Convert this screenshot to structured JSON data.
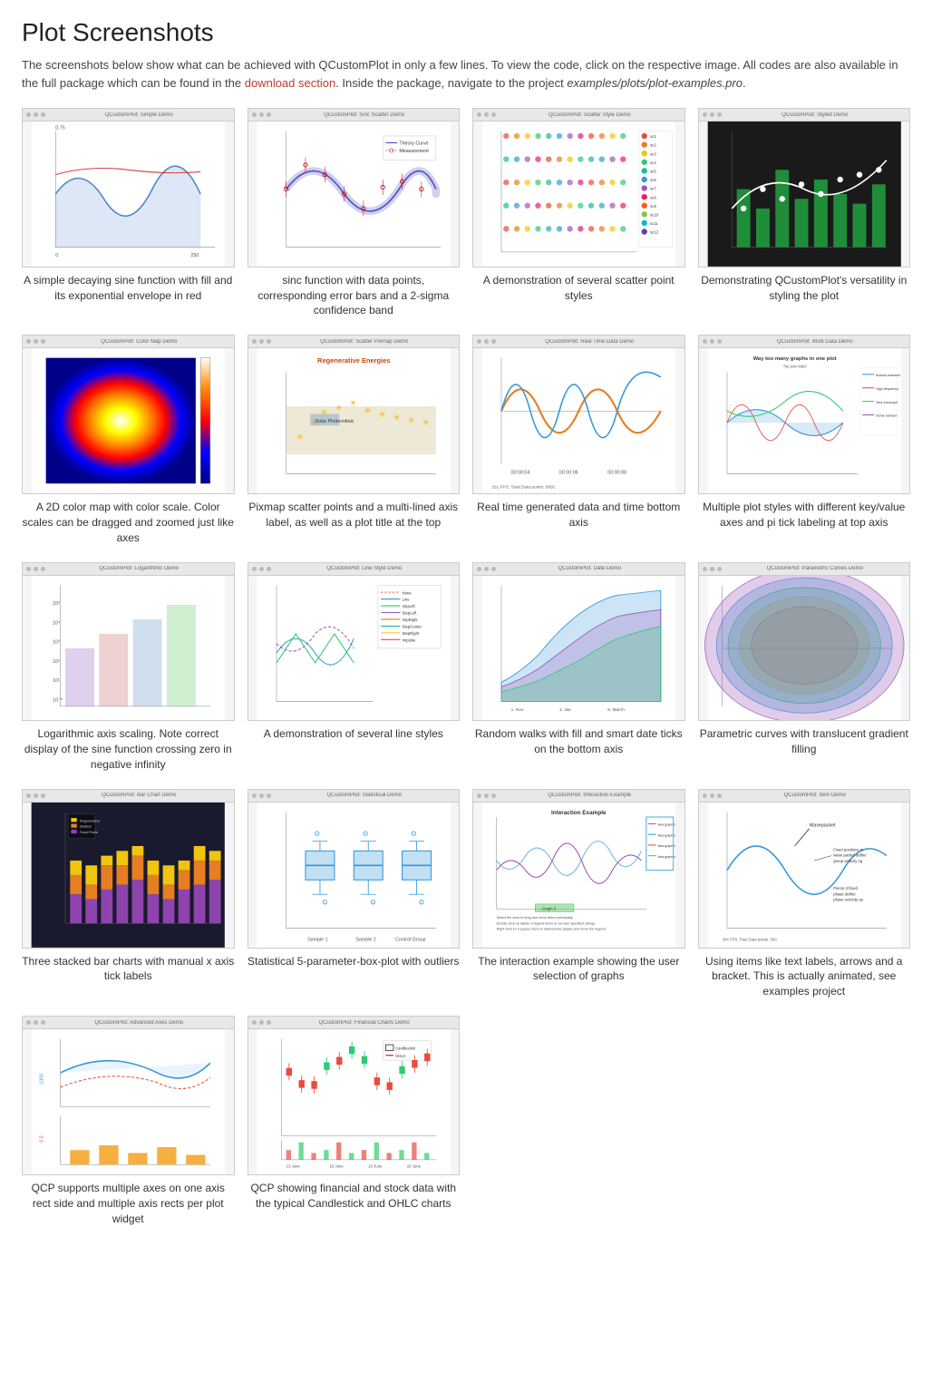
{
  "page": {
    "title": "Plot Screenshots",
    "intro_part1": "The screenshots below show what can be achieved with QCustomPlot in only a few lines. To view the code, click on the respective image. All codes are also available in the full package which can be found in the ",
    "intro_link": "download section",
    "intro_part2": ". Inside the package, navigate to the project ",
    "intro_path": "examples/plots/plot-examples.pro",
    "intro_end": "."
  },
  "plots": [
    {
      "id": "simple-demo",
      "chrome_title": "QCustomPlot: Simple Demo",
      "caption": "A simple decaying sine function with fill and its exponential envelope in red",
      "highlight_words": [],
      "color_scheme": "blue_red",
      "type": "line"
    },
    {
      "id": "sinc-scatter",
      "chrome_title": "QCustomPlot: Sinc Scatter Demo",
      "caption": "sinc function with data points, corresponding error bars and a 2-sigma confidence band",
      "highlight_words": [],
      "color_scheme": "red_blue",
      "type": "scatter_line"
    },
    {
      "id": "scatter-style",
      "chrome_title": "QCustomPlot: Scatter Style Demo",
      "caption": "A demonstration of several scatter point styles",
      "highlight_words": [
        "demonstration",
        "scatter"
      ],
      "color_scheme": "multicolor",
      "type": "scatter_multi"
    },
    {
      "id": "styled-demo",
      "chrome_title": "QCustomPlot: Styled Demo",
      "caption": "Demonstrating QCustomPlot's versatility in styling the plot",
      "highlight_words": [],
      "color_scheme": "dark_green",
      "type": "bar_dark"
    },
    {
      "id": "colormap",
      "chrome_title": "QCustomPlot: Color Map Demo",
      "caption": "A 2D color map with color scale. Color scales can be dragged and zoomed just like axes",
      "highlight_words": [],
      "color_scheme": "heatmap",
      "type": "colormap"
    },
    {
      "id": "scatter-pixmap",
      "chrome_title": "QCustomPlot: Scatter Pixmap Demo",
      "caption": "Pixmap scatter points and a multi-lined axis label, as well as a plot title at the top",
      "highlight_words": [],
      "color_scheme": "energy",
      "type": "pixmap_scatter"
    },
    {
      "id": "realtime",
      "chrome_title": "QCustomPlot: Real Time Data Demo",
      "caption": "Real time generated data and time bottom axis",
      "highlight_words": [
        "time"
      ],
      "color_scheme": "orange_blue",
      "type": "realtime"
    },
    {
      "id": "multi-data",
      "chrome_title": "QCustomPlot: Multi Data Demo",
      "caption": "Multiple plot styles with different key/value axes and pi tick labeling at top axis",
      "highlight_words": [
        "different"
      ],
      "color_scheme": "multi_axes",
      "type": "multi_axes"
    },
    {
      "id": "logarithmic",
      "chrome_title": "QCustomPlot: Logarithmic Demo",
      "caption": "Logarithmic axis scaling. Note correct display of the sine function crossing zero in negative infinity",
      "highlight_words": [],
      "color_scheme": "log_colors",
      "type": "logarithmic"
    },
    {
      "id": "line-style",
      "chrome_title": "QCustomPlot: Line Style Demo",
      "caption": "A demonstration of several line styles",
      "highlight_words": [],
      "color_scheme": "line_styles",
      "type": "line_styles"
    },
    {
      "id": "date-demo",
      "chrome_title": "QCustomPlot: Date Demo",
      "caption": "Random walks with fill and smart date ticks on the bottom axis",
      "highlight_words": [
        "fill"
      ],
      "color_scheme": "area_fill",
      "type": "area"
    },
    {
      "id": "parametric",
      "chrome_title": "QCustomPlot: Parametric Curves Demo",
      "caption": "Parametric curves with translucent gradient filling",
      "highlight_words": [],
      "color_scheme": "ellipses",
      "type": "parametric"
    },
    {
      "id": "bar-chart",
      "chrome_title": "QCustomPlot: Bar Chart Demo",
      "caption": "Three stacked bar charts with manual x axis tick labels",
      "highlight_words": [],
      "color_scheme": "bar_colors",
      "type": "bar_stacked"
    },
    {
      "id": "statistical",
      "chrome_title": "QCustomPlot: Statistical Demo",
      "caption": "Statistical 5-parameter-box-plot with outliers",
      "highlight_words": [],
      "color_scheme": "boxplot",
      "type": "boxplot"
    },
    {
      "id": "interaction",
      "chrome_title": "QCustomPlot: Interaction Example",
      "caption": "The interaction example showing the user selection of graphs",
      "highlight_words": [
        "selection"
      ],
      "color_scheme": "interaction",
      "type": "interaction"
    },
    {
      "id": "item-demo",
      "chrome_title": "QCustomPlot: Item Demo",
      "caption": "Using items like text labels, arrows and a bracket. This is actually animated, see examples project",
      "highlight_words": [],
      "color_scheme": "item_demo",
      "type": "item_demo"
    },
    {
      "id": "advanced-axes",
      "chrome_title": "QCustomPlot: Advanced Axes Demo",
      "caption": "QCP supports multiple axes on one axis rect side and multiple axis rects per plot widget",
      "highlight_words": [],
      "color_scheme": "multi_axes2",
      "type": "advanced_axes"
    },
    {
      "id": "financial",
      "chrome_title": "QCustomPlot: Financial Charts Demo",
      "caption": "QCP showing financial and stock data with the typical Candlestick and OHLC charts",
      "highlight_words": [
        "Candlestick",
        "OHLC"
      ],
      "color_scheme": "financial",
      "type": "financial"
    }
  ]
}
